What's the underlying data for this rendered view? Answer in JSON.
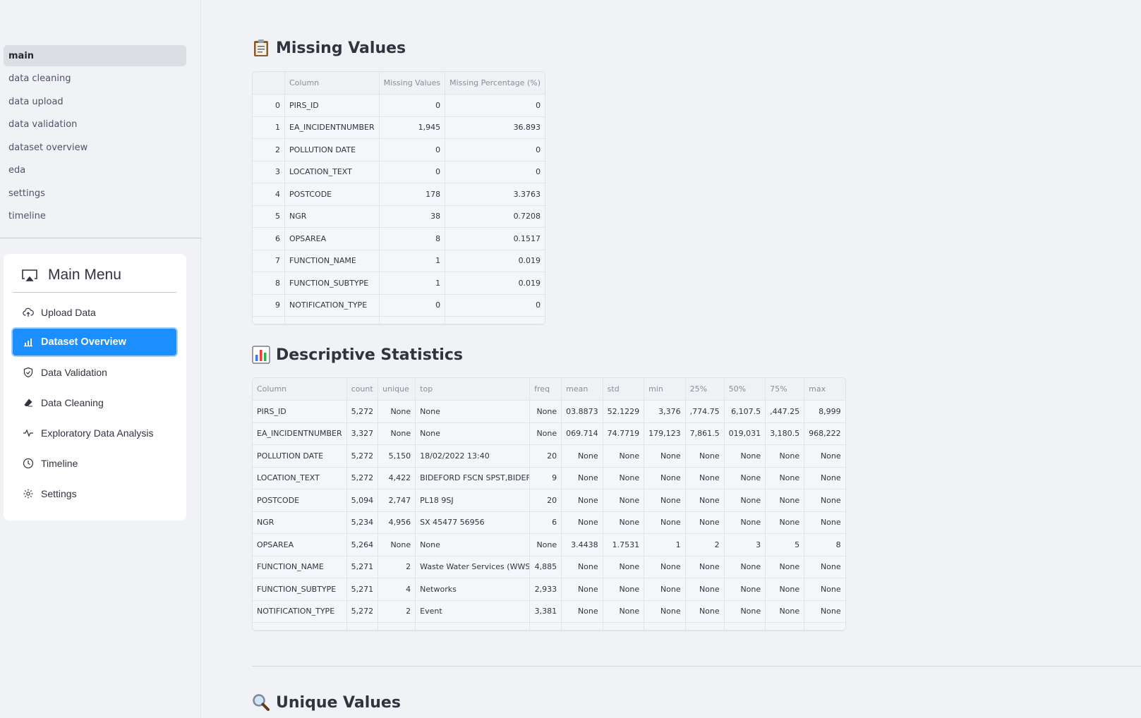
{
  "sidebar": {
    "nav": [
      {
        "label": "main",
        "active": true
      },
      {
        "label": "data cleaning"
      },
      {
        "label": "data upload"
      },
      {
        "label": "data validation"
      },
      {
        "label": "dataset overview"
      },
      {
        "label": "eda"
      },
      {
        "label": "settings"
      },
      {
        "label": "timeline"
      }
    ],
    "menu": {
      "title": "Main Menu",
      "title_icon": "screen-cast-icon",
      "items": [
        {
          "label": "Upload Data",
          "icon": "cloud-upload-icon"
        },
        {
          "label": "Dataset Overview",
          "icon": "bar-chart-icon",
          "active": true
        },
        {
          "label": "Data Validation",
          "icon": "shield-check-icon"
        },
        {
          "label": "Data Cleaning",
          "icon": "eraser-icon"
        },
        {
          "label": "Exploratory Data Analysis",
          "icon": "activity-icon"
        },
        {
          "label": "Timeline",
          "icon": "clock-icon"
        },
        {
          "label": "Settings",
          "icon": "gear-icon"
        }
      ]
    }
  },
  "main": {
    "missing": {
      "title": "Missing Values",
      "emoji": "clipboard-icon",
      "headers": [
        "",
        "Column",
        "Missing Values",
        "Missing Percentage (%)"
      ],
      "rows": [
        [
          "0",
          "PIRS_ID",
          "0",
          "0"
        ],
        [
          "1",
          "EA_INCIDENTNUMBER",
          "1,945",
          "36.893"
        ],
        [
          "2",
          "POLLUTION DATE",
          "0",
          "0"
        ],
        [
          "3",
          "LOCATION_TEXT",
          "0",
          "0"
        ],
        [
          "4",
          "POSTCODE",
          "178",
          "3.3763"
        ],
        [
          "5",
          "NGR",
          "38",
          "0.7208"
        ],
        [
          "6",
          "OPSAREA",
          "8",
          "0.1517"
        ],
        [
          "7",
          "FUNCTION_NAME",
          "1",
          "0.019"
        ],
        [
          "8",
          "FUNCTION_SUBTYPE",
          "1",
          "0.019"
        ],
        [
          "9",
          "NOTIFICATION_TYPE",
          "0",
          "0"
        ]
      ]
    },
    "describe": {
      "title": "Descriptive Statistics",
      "emoji": "bar-chart-emoji-icon",
      "headers": [
        "Column",
        "count",
        "unique",
        "top",
        "freq",
        "mean",
        "std",
        "min",
        "25%",
        "50%",
        "75%",
        "max"
      ],
      "rows": [
        [
          "PIRS_ID",
          "5,272",
          "None",
          "None",
          "None",
          "03.8873",
          "52.1229",
          "3,376",
          ",774.75",
          "6,107.5",
          ",447.25",
          "8,999"
        ],
        [
          "EA_INCIDENTNUMBER",
          "3,327",
          "None",
          "None",
          "None",
          "069.714",
          "74.7719",
          "179,123",
          "7,861.5",
          "019,031",
          "3,180.5",
          "968,222"
        ],
        [
          "POLLUTION DATE",
          "5,272",
          "5,150",
          "18/02/2022 13:40",
          "20",
          "None",
          "None",
          "None",
          "None",
          "None",
          "None",
          "None"
        ],
        [
          "LOCATION_TEXT",
          "5,272",
          "4,422",
          "BIDEFORD FSCN SPST,BIDEFORD",
          "9",
          "None",
          "None",
          "None",
          "None",
          "None",
          "None",
          "None"
        ],
        [
          "POSTCODE",
          "5,094",
          "2,747",
          "PL18 9SJ",
          "20",
          "None",
          "None",
          "None",
          "None",
          "None",
          "None",
          "None"
        ],
        [
          "NGR",
          "5,234",
          "4,956",
          "SX 45477 56956",
          "6",
          "None",
          "None",
          "None",
          "None",
          "None",
          "None",
          "None"
        ],
        [
          "OPSAREA",
          "5,264",
          "None",
          "None",
          "None",
          "3.4438",
          "1.7531",
          "1",
          "2",
          "3",
          "5",
          "8"
        ],
        [
          "FUNCTION_NAME",
          "5,271",
          "2",
          "Waste Water Services (WWS)",
          "4,885",
          "None",
          "None",
          "None",
          "None",
          "None",
          "None",
          "None"
        ],
        [
          "FUNCTION_SUBTYPE",
          "5,271",
          "4",
          "Networks",
          "2,933",
          "None",
          "None",
          "None",
          "None",
          "None",
          "None",
          "None"
        ],
        [
          "NOTIFICATION_TYPE",
          "5,272",
          "2",
          "Event",
          "3,381",
          "None",
          "None",
          "None",
          "None",
          "None",
          "None",
          "None"
        ]
      ]
    },
    "unique": {
      "title": "Unique Values",
      "emoji": "magnifier-icon"
    }
  }
}
